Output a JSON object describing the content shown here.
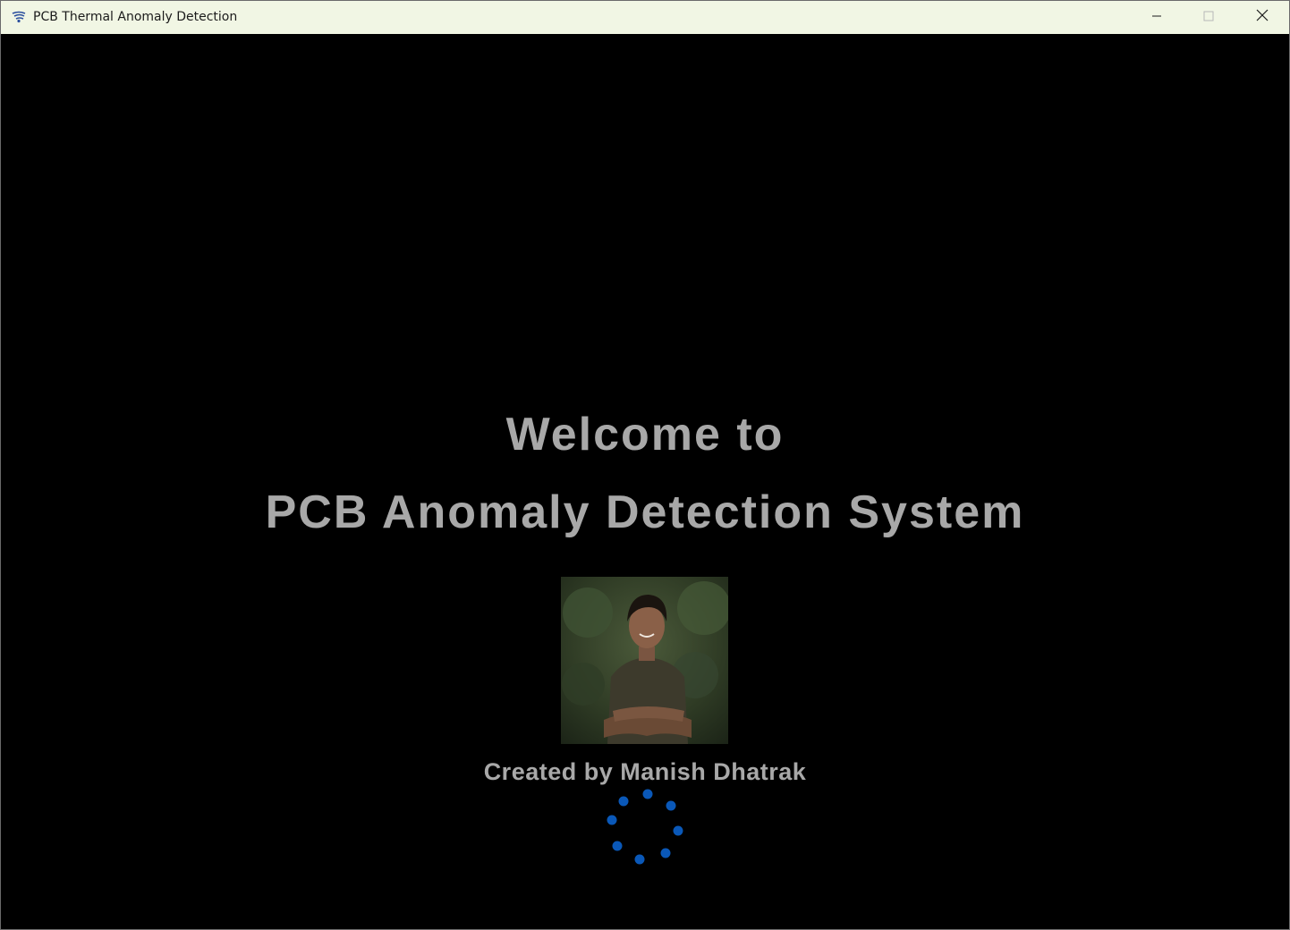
{
  "window": {
    "title": "PCB Thermal Anomaly Detection",
    "icons": {
      "app": "app-logo-icon",
      "minimize": "minimize-icon",
      "maximize": "maximize-icon",
      "close": "close-icon"
    },
    "titlebar_color": "#f1f6e4"
  },
  "splash": {
    "line1": "Welcome to",
    "line2": "PCB Anomaly Detection System",
    "creator": "Created by Manish Dhatrak",
    "text_color": "#a8a8a8",
    "background": "#000000",
    "spinner_color": "#0a58b8",
    "photo_alt": "creator-photo"
  }
}
